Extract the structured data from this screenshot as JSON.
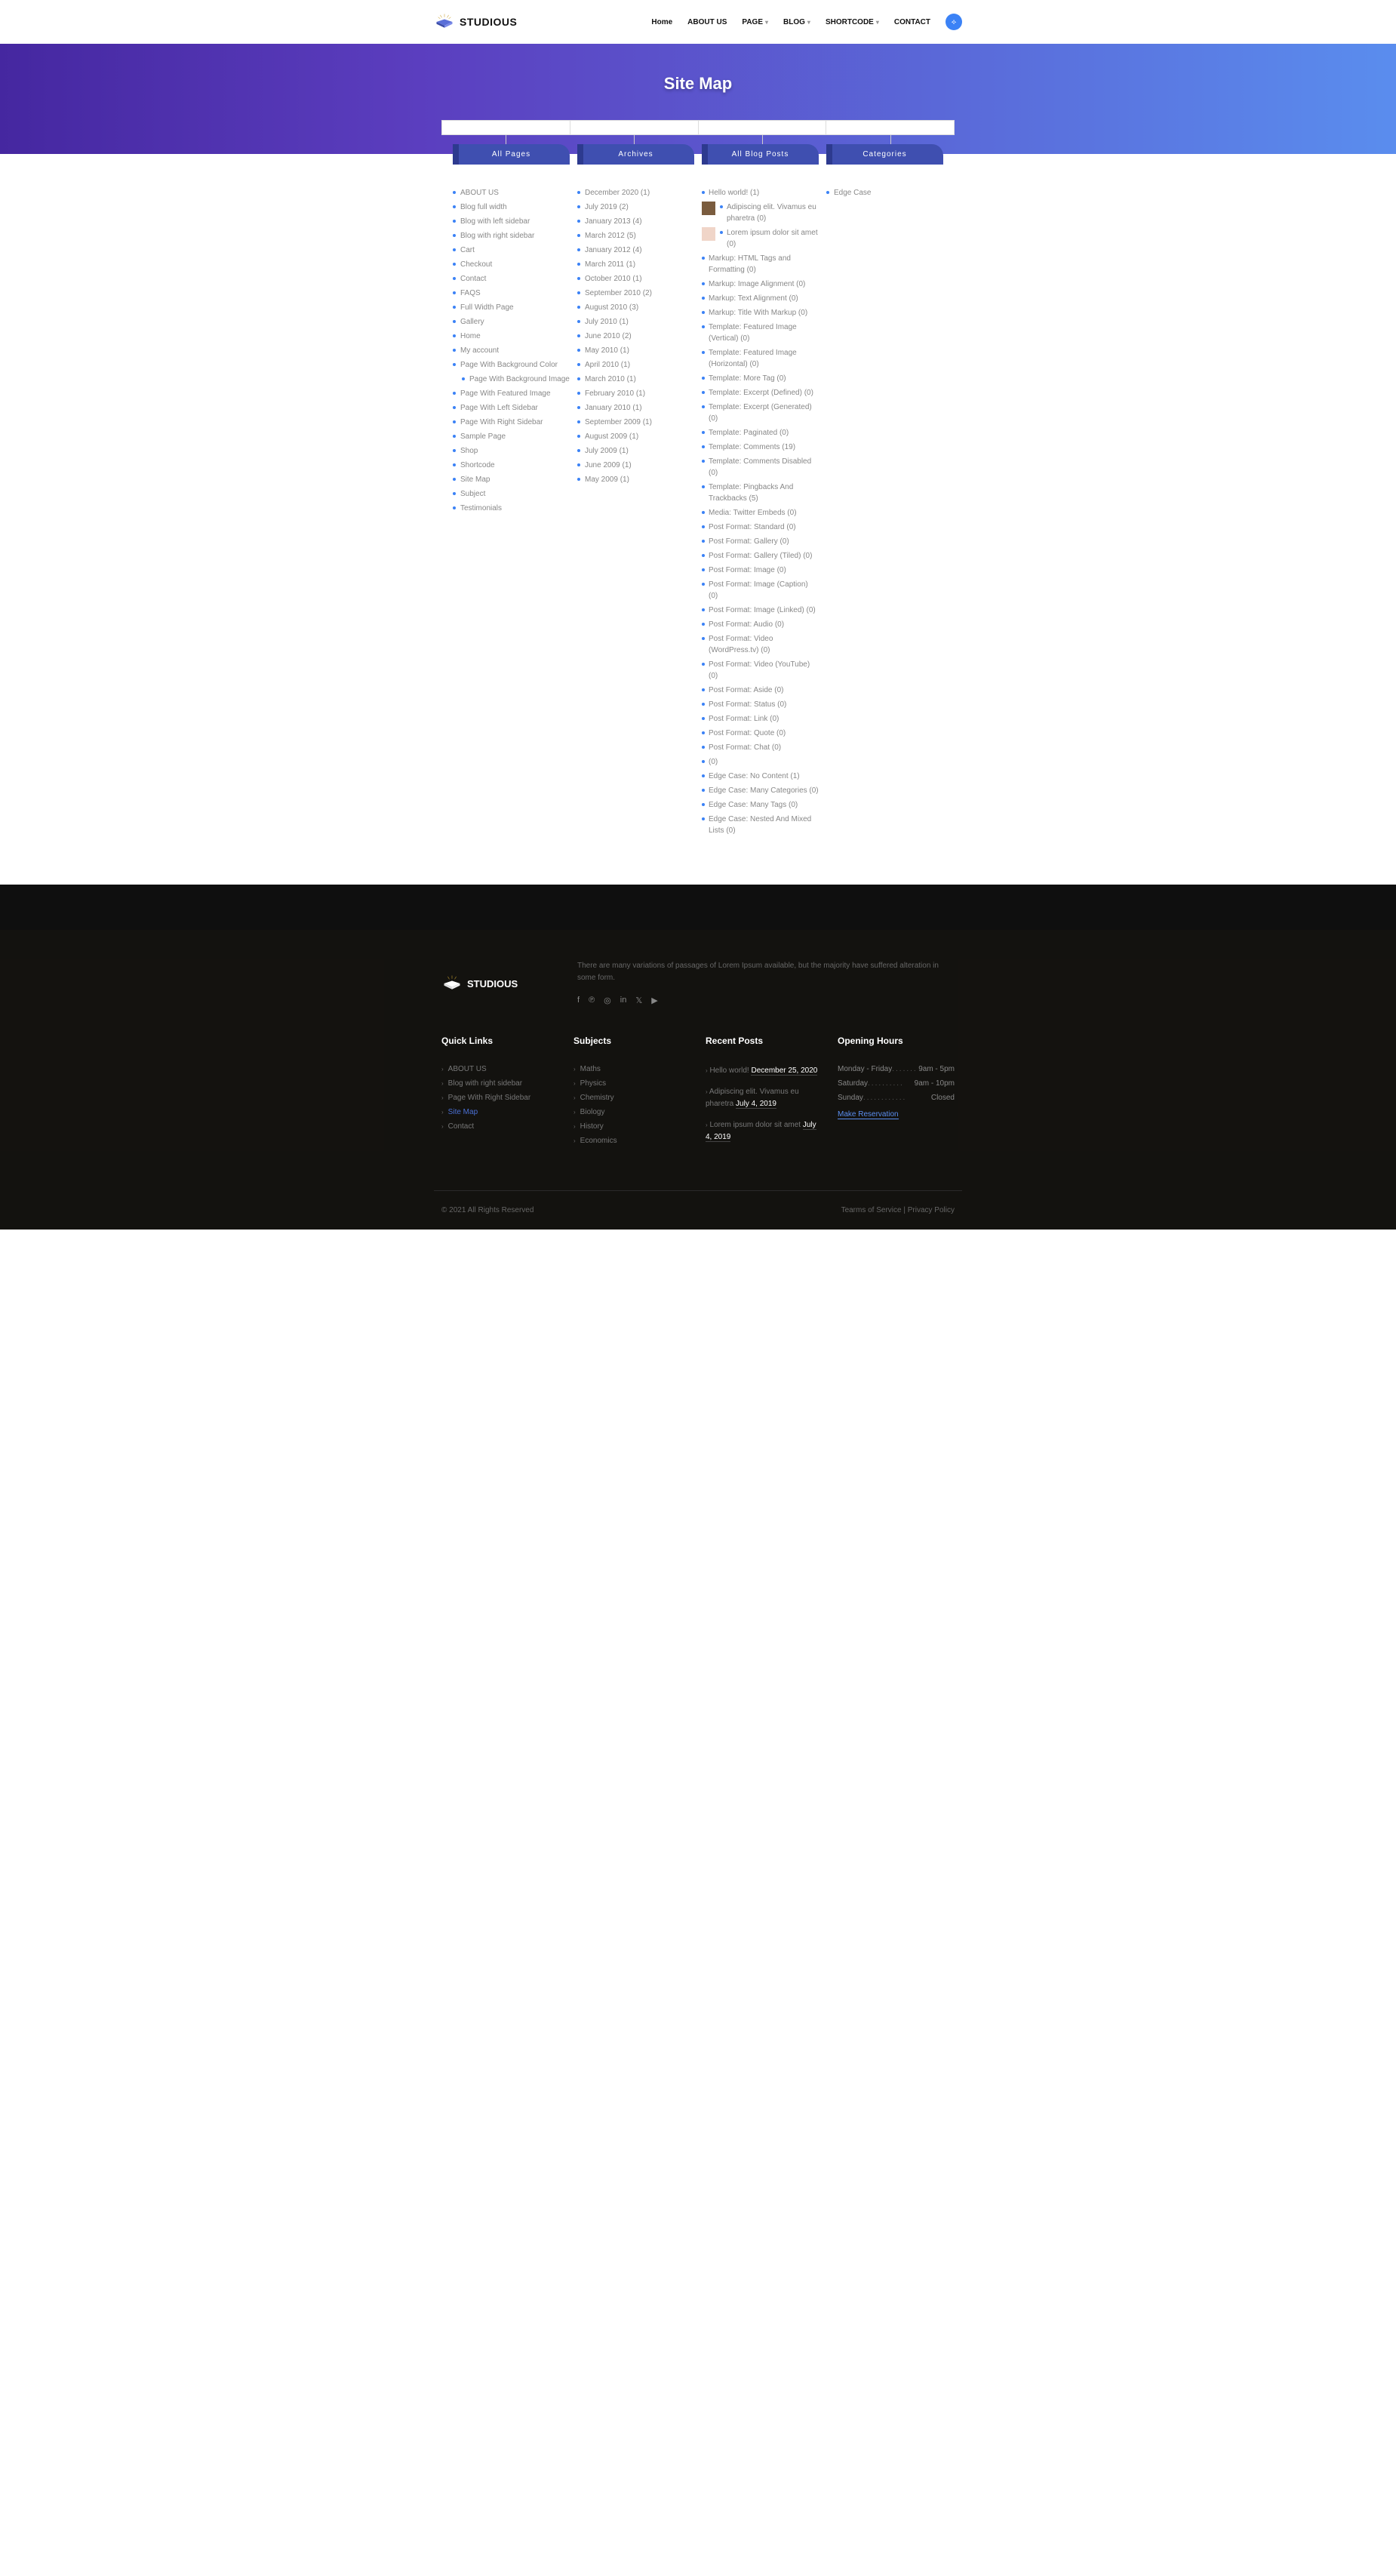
{
  "brand": "STUDIOUS",
  "nav": {
    "home": "Home",
    "about": "ABOUT US",
    "page": "PAGE",
    "blog": "BLOG",
    "shortcode": "SHORTCODE",
    "contact": "CONTACT"
  },
  "hero": {
    "title": "Site Map"
  },
  "tabs": {
    "pages": "All Pages",
    "archives": "Archives",
    "posts": "All Blog Posts",
    "cats": "Categories"
  },
  "pages": [
    "ABOUT US",
    "Blog full width",
    "Blog with left sidebar",
    "Blog with right sidebar",
    "Cart",
    "Checkout",
    "Contact",
    "FAQS",
    "Full Width Page",
    "Gallery",
    "Home",
    "My account",
    "Page With Background Color"
  ],
  "pages2": [
    "Page With Background Image"
  ],
  "pages3": [
    "Page With Featured Image",
    "Page With Left Sidebar",
    "Page With Right Sidebar",
    "Sample Page",
    "Shop",
    "Shortcode",
    "Site Map",
    "Subject",
    "Testimonials"
  ],
  "archives": [
    "December 2020 (1)",
    "July 2019 (2)",
    "January 2013 (4)",
    "March 2012 (5)",
    "January 2012 (4)",
    "March 2011 (1)",
    "October 2010 (1)",
    "September 2010 (2)",
    "August 2010 (3)",
    "July 2010 (1)",
    "June 2010 (2)",
    "May 2010 (1)",
    "April 2010 (1)",
    "March 2010 (1)",
    "February 2010 (1)",
    "January 2010 (1)",
    "September 2009 (1)",
    "August 2009 (1)",
    "July 2009 (1)",
    "June 2009 (1)",
    "May 2009 (1)"
  ],
  "posts": [
    {
      "t": "Hello world! (1)",
      "thumb": false
    },
    {
      "t": "Adipiscing elit. Vivamus eu pharetra (0)",
      "thumb": "dark"
    },
    {
      "t": "Lorem ipsum dolor sit amet (0)",
      "thumb": "light"
    },
    {
      "t": "Markup: HTML Tags and Formatting (0)"
    },
    {
      "t": "Markup: Image Alignment (0)"
    },
    {
      "t": "Markup: Text Alignment (0)"
    },
    {
      "t": "Markup: Title With Markup (0)"
    },
    {
      "t": "Template: Featured Image (Vertical) (0)"
    },
    {
      "t": "Template: Featured Image (Horizontal) (0)"
    },
    {
      "t": "Template: More Tag (0)"
    },
    {
      "t": "Template: Excerpt (Defined) (0)"
    },
    {
      "t": "Template: Excerpt (Generated) (0)"
    },
    {
      "t": "Template: Paginated (0)"
    },
    {
      "t": "Template: Comments (19)"
    },
    {
      "t": "Template: Comments Disabled (0)"
    },
    {
      "t": "Template: Pingbacks And Trackbacks (5)"
    },
    {
      "t": "Media: Twitter Embeds (0)"
    },
    {
      "t": "Post Format: Standard (0)"
    },
    {
      "t": "Post Format: Gallery (0)"
    },
    {
      "t": "Post Format: Gallery (Tiled) (0)"
    },
    {
      "t": "Post Format: Image (0)"
    },
    {
      "t": "Post Format: Image (Caption) (0)"
    },
    {
      "t": "Post Format: Image (Linked) (0)"
    },
    {
      "t": "Post Format: Audio (0)"
    },
    {
      "t": "Post Format: Video (WordPress.tv) (0)"
    },
    {
      "t": "Post Format: Video (YouTube) (0)"
    },
    {
      "t": "Post Format: Aside (0)"
    },
    {
      "t": "Post Format: Status (0)"
    },
    {
      "t": "Post Format: Link (0)"
    },
    {
      "t": "Post Format: Quote (0)"
    },
    {
      "t": "Post Format: Chat (0)"
    },
    {
      "t": " (0)"
    },
    {
      "t": "Edge Case: No Content (1)"
    },
    {
      "t": "Edge Case: Many Categories (0)"
    },
    {
      "t": "Edge Case: Many Tags (0)"
    },
    {
      "t": "Edge Case: Nested And Mixed Lists (0)"
    }
  ],
  "cats": [
    "Edge Case"
  ],
  "footer": {
    "desc": "There are many variations of passages of Lorem Ipsum available, but the majority have suffered alteration in some form.",
    "quick": {
      "h": "Quick Links",
      "items": [
        "ABOUT US",
        "Blog with right sidebar",
        "Page With Right Sidebar",
        "Site Map",
        "Contact"
      ]
    },
    "subj": {
      "h": "Subjects",
      "items": [
        "Maths",
        "Physics",
        "Chemistry",
        "Biology",
        "History",
        "Economics"
      ]
    },
    "recent": {
      "h": "Recent Posts",
      "p1a": "Hello world! ",
      "p1b": "December 25, 2020",
      "p2a": "Adipiscing elit. Vivamus eu pharetra ",
      "p2b": "July 4, 2019",
      "p3a": "Lorem ipsum dolor sit amet ",
      "p3b": "July 4, 2019"
    },
    "hours": {
      "h": "Opening Hours",
      "r1a": "Monday - Friday",
      "r1b": "9am - 5pm",
      "r2a": "Saturday",
      "r2b": "9am - 10pm",
      "r3a": "Sunday",
      "r3b": "Closed",
      "res": "Make Reservation"
    },
    "copy": "© 2021 All Rights Reserved",
    "terms": "Tearms of Service",
    "privacy": "Privacy Policy"
  }
}
